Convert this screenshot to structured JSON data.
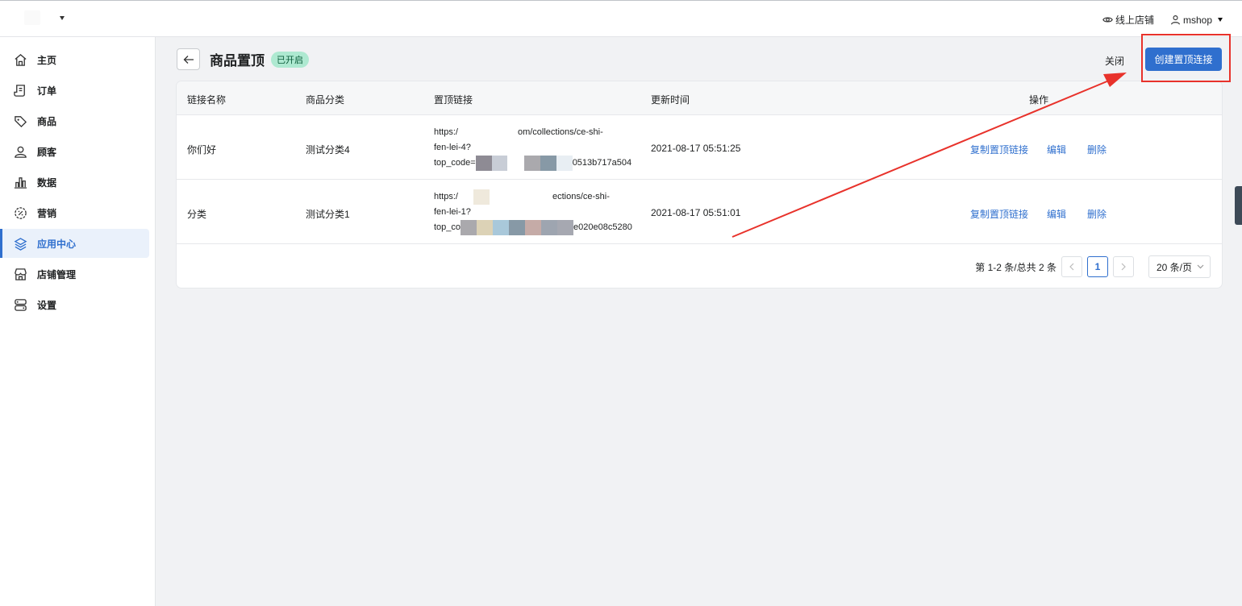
{
  "topbar": {
    "online_store": "线上店铺",
    "user": "mshop"
  },
  "sidebar": {
    "items": [
      {
        "label": "主页",
        "icon": "home-icon"
      },
      {
        "label": "订单",
        "icon": "order-icon"
      },
      {
        "label": "商品",
        "icon": "tag-icon"
      },
      {
        "label": "顾客",
        "icon": "customer-icon"
      },
      {
        "label": "数据",
        "icon": "chart-icon"
      },
      {
        "label": "营销",
        "icon": "marketing-icon"
      },
      {
        "label": "应用中心",
        "icon": "apps-icon",
        "active": true
      },
      {
        "label": "店铺管理",
        "icon": "store-icon"
      },
      {
        "label": "设置",
        "icon": "settings-icon"
      }
    ]
  },
  "page": {
    "title": "商品置顶",
    "status_badge": "已开启",
    "close_label": "关闭",
    "create_label": "创建置顶连接"
  },
  "table": {
    "headers": [
      "链接名称",
      "商品分类",
      "置顶链接",
      "更新时间",
      "操作"
    ],
    "rows": [
      {
        "name": "你们好",
        "category": "测试分类4",
        "link_line1": "https:/",
        "link_line1_tail": "om/collections/ce-shi-",
        "link_line2": "fen-lei-4?",
        "link_line3_head": "top_code=",
        "link_line3_tail": "0513b717a504",
        "updated": "2021-08-17 05:51:25"
      },
      {
        "name": "分类",
        "category": "测试分类1",
        "link_line1": "https:/",
        "link_line1_tail": "ections/ce-shi-",
        "link_line2": "fen-lei-1?",
        "link_line3_head": "top_co",
        "link_line3_tail": "e020e08c5280",
        "updated": "2021-08-17 05:51:01"
      }
    ],
    "actions": {
      "copy": "复制置顶链接",
      "edit": "编辑",
      "delete": "删除"
    }
  },
  "pagination": {
    "summary": "第 1-2 条/总共 2 条",
    "current_page": "1",
    "page_size": "20 条/页"
  },
  "colors": {
    "primary": "#2f6fce",
    "badge_bg": "#aee9d1",
    "annotation": "#e8322b"
  }
}
